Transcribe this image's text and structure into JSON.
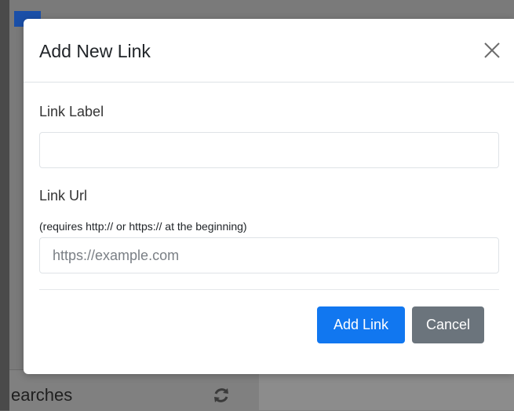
{
  "background": {
    "status_text": "earches",
    "refresh_icon": "refresh-icon"
  },
  "modal": {
    "title": "Add New Link",
    "close_icon": "close-icon",
    "label_field": {
      "label": "Link Label",
      "value": "",
      "placeholder": ""
    },
    "url_field": {
      "label": "Link Url",
      "hint": "(requires http:// or https:// at the beginning)",
      "value": "",
      "placeholder": "https://example.com"
    },
    "buttons": {
      "add_label": "Add Link",
      "cancel_label": "Cancel"
    }
  },
  "colors": {
    "primary": "#1177f0",
    "secondary": "#6b747c"
  }
}
